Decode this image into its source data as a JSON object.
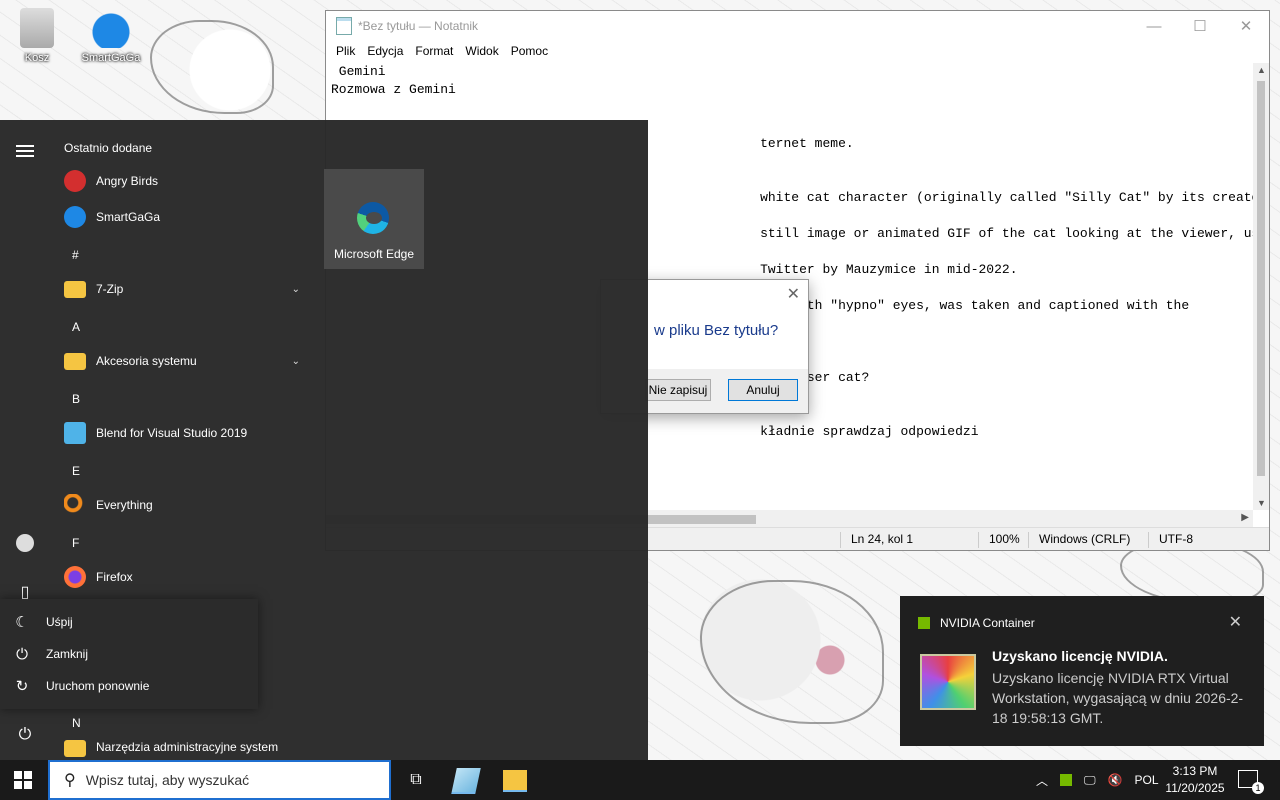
{
  "desktop": {
    "icons": [
      {
        "label": "Kosz"
      },
      {
        "label": "SmartGaGa"
      }
    ]
  },
  "notepad": {
    "title": "*Bez tytułu — Notatnik",
    "menu": [
      "Plik",
      "Edycja",
      "Format",
      "Widok",
      "Pomoc"
    ],
    "lines": [
      " Gemini",
      "Rozmowa z Gemini",
      "",
      "",
      "                                                       ternet meme.",
      "",
      "",
      "                                                       white cat character (originally called \"Silly Cat\" by its creator, artist",
      "",
      "                                                       still image or animated GIF of the cat looking at the viewer, usually acco",
      "",
      "                                                       Twitter by Mauzymice in mid-2022.",
      "",
      "                                                       tat with \"hypno\" eyes, was taken and captioned with the",
      "",
      "                                                       ernet.",
      "",
      "                                                       boykisser cat?",
      "",
      "",
      "                                                       kładnie sprawdzaj odpowiedzi"
    ],
    "status": {
      "position": "Ln 24, kol 1",
      "zoom": "100%",
      "line_ending": "Windows (CRLF)",
      "encoding": "UTF-8"
    }
  },
  "dialog": {
    "question": "w pliku Bez tytułu?",
    "dont_save": "Nie zapisuj",
    "cancel": "Anuluj"
  },
  "start_menu": {
    "header": "Ostatnio dodane",
    "apps": [
      {
        "name": "Angry Birds",
        "color": "#d32f2f"
      },
      {
        "name": "SmartGaGa",
        "color": "#1e88e5"
      },
      {
        "name": "7-Zip",
        "color": "#f5c542"
      },
      {
        "name": "Akcesoria systemu",
        "color": "#f5c542"
      },
      {
        "name": "Blend for Visual Studio 2019",
        "color": "#4fb3e8"
      },
      {
        "name": "Everything",
        "color": "#f08a1c"
      },
      {
        "name": "Firefox",
        "color": "#ff7139"
      },
      {
        "name": "Narzędzia administracyjne system",
        "color": "#f5c542"
      }
    ],
    "letters": [
      "#",
      "A",
      "B",
      "E",
      "F",
      "N"
    ],
    "tile": "Microsoft Edge",
    "power_menu": [
      "Uśpij",
      "Zamknij",
      "Uruchom ponownie"
    ]
  },
  "toast": {
    "app": "NVIDIA Container",
    "heading": "Uzyskano licencję NVIDIA.",
    "body": "Uzyskano licencję NVIDIA RTX Virtual Workstation, wygasającą w dniu 2026-2-18 19:58:13 GMT."
  },
  "taskbar": {
    "search_placeholder": "Wpisz tutaj, aby wyszukać",
    "language": "POL",
    "time": "3:13 PM",
    "date": "11/20/2025",
    "notifications": "1"
  }
}
